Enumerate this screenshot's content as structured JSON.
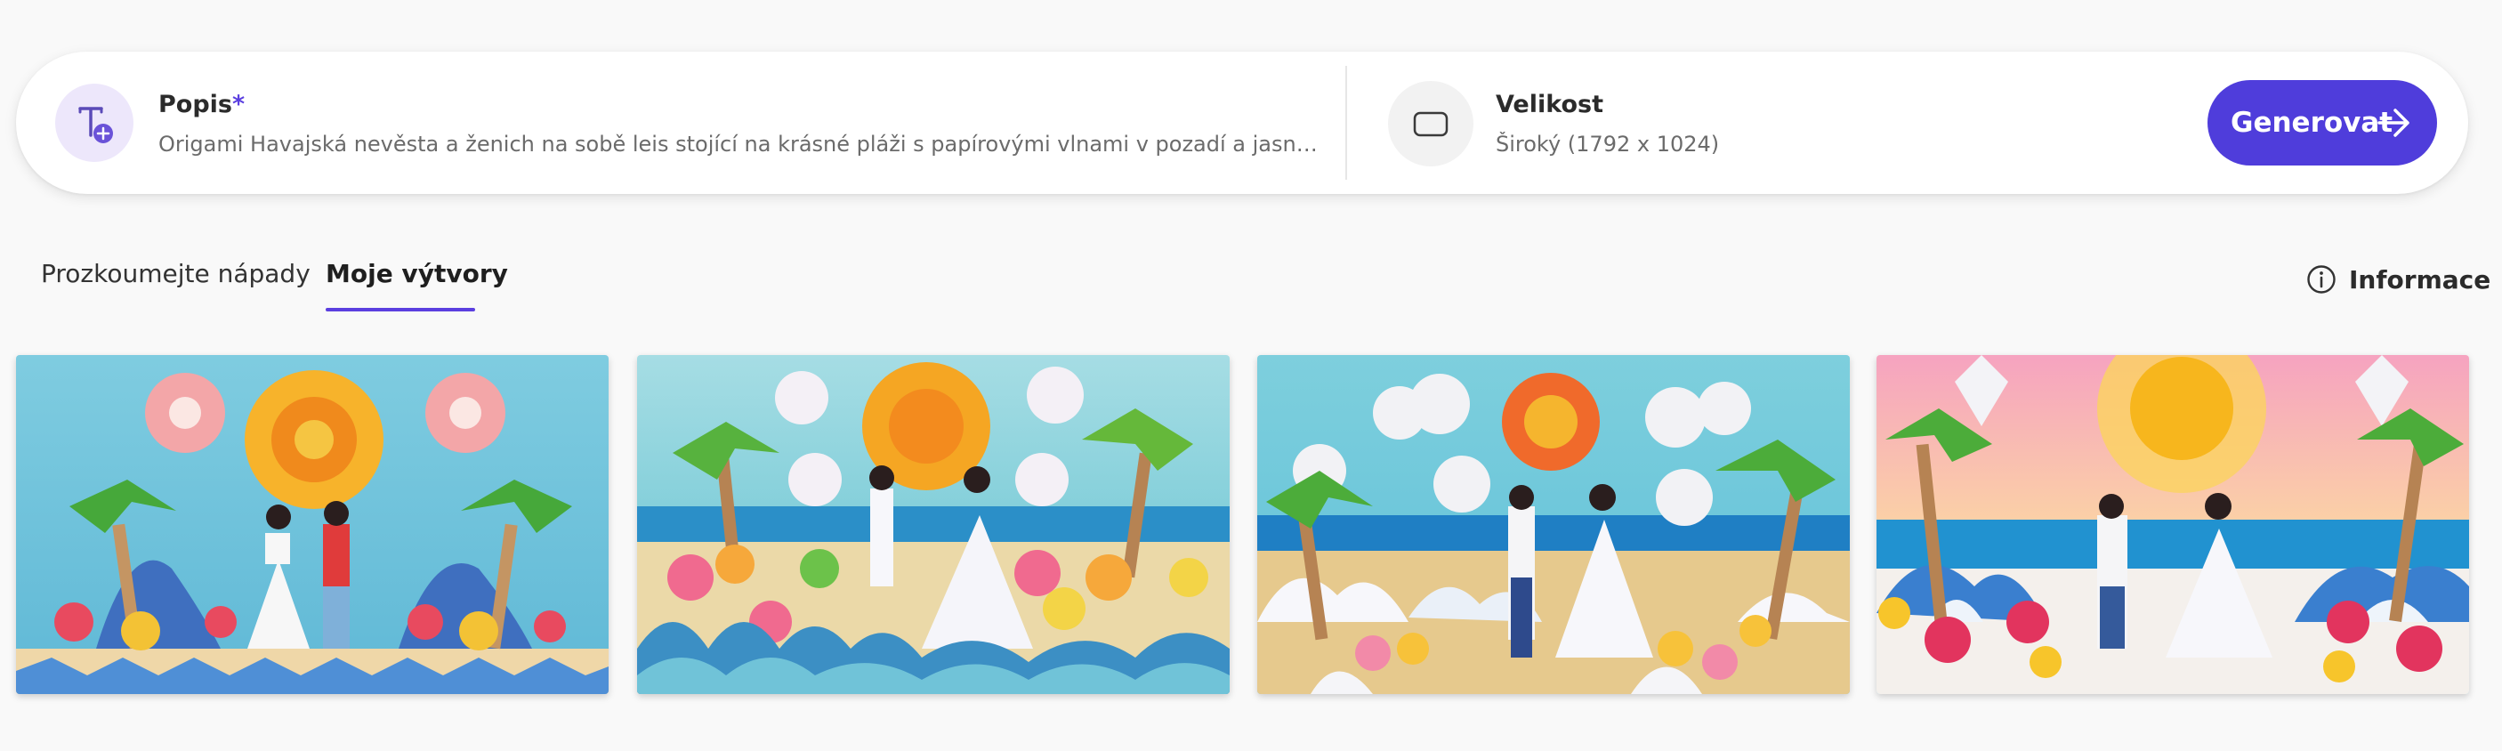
{
  "prompt": {
    "label": "Popis",
    "required_mark": "*",
    "value": "Origami Havajská nevěsta a ženich na sobě leis stojící na krásné pláži s papírovými vlnami v pozadí a jasným sluncem na...",
    "icon": "text-add-icon"
  },
  "size": {
    "label": "Velikost",
    "value": "Široký (1792 x 1024)",
    "icon": "aspect-ratio-icon"
  },
  "generate_button": {
    "label": "Generovat",
    "icon": "arrow-right-icon",
    "color": "#4f3ddb"
  },
  "tabs": [
    {
      "label": "Prozkoumejte nápady",
      "active": false
    },
    {
      "label": "Moje výtvory",
      "active": true
    }
  ],
  "info": {
    "label": "Informace",
    "icon": "info-icon"
  },
  "accent_color": "#5b3fe0",
  "images": [
    {
      "name": "generated-image-1"
    },
    {
      "name": "generated-image-2"
    },
    {
      "name": "generated-image-3"
    },
    {
      "name": "generated-image-4"
    }
  ]
}
